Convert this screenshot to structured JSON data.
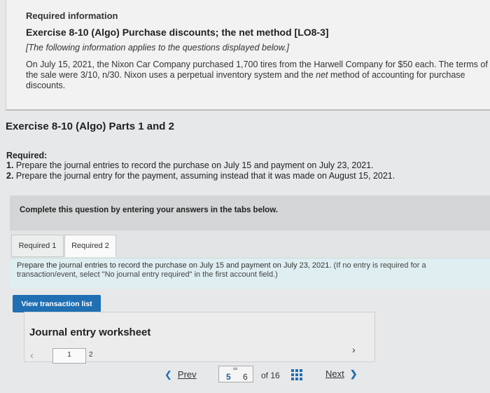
{
  "info": {
    "heading": "Required information",
    "exercise_title": "Exercise 8-10 (Algo) Purchase discounts; the net method [LO8-3]",
    "note": "[The following information applies to the questions displayed below.]",
    "scenario_before_net": "On July 15, 2021, the Nixon Car Company purchased 1,700 tires from the Harwell Company for $50 each. The terms of the sale were 3/10, n/30. Nixon uses a perpetual inventory system and the ",
    "scenario_net": "net",
    "scenario_after_net": " method of accounting for purchase discounts."
  },
  "parts": {
    "title": "Exercise 8-10 (Algo) Parts 1 and 2",
    "required_label": "Required:",
    "items": [
      {
        "num": "1.",
        "text": "Prepare the journal entries to record the purchase on July 15 and payment on July 23, 2021."
      },
      {
        "num": "2.",
        "text": "Prepare the journal entry for the payment, assuming instead that it was made on August 15, 2021."
      }
    ]
  },
  "complete_prompt": "Complete this question by entering your answers in the tabs below.",
  "tabs": [
    {
      "label": "Required 1"
    },
    {
      "label": "Required 2"
    }
  ],
  "instruction": {
    "main": "Prepare the journal entries to record the purchase on July 15 and payment on July 23, 2021. ",
    "note": "(If no entry is required for a transaction/event, select \"No journal entry required\" in the first account field.)"
  },
  "view_button": "View transaction list",
  "worksheet": {
    "title": "Journal entry worksheet",
    "pages": [
      "1",
      "2"
    ]
  },
  "pager": {
    "prev": "Prev",
    "current_pages": [
      "5",
      "6"
    ],
    "of_total": "of 16",
    "next": "Next"
  }
}
